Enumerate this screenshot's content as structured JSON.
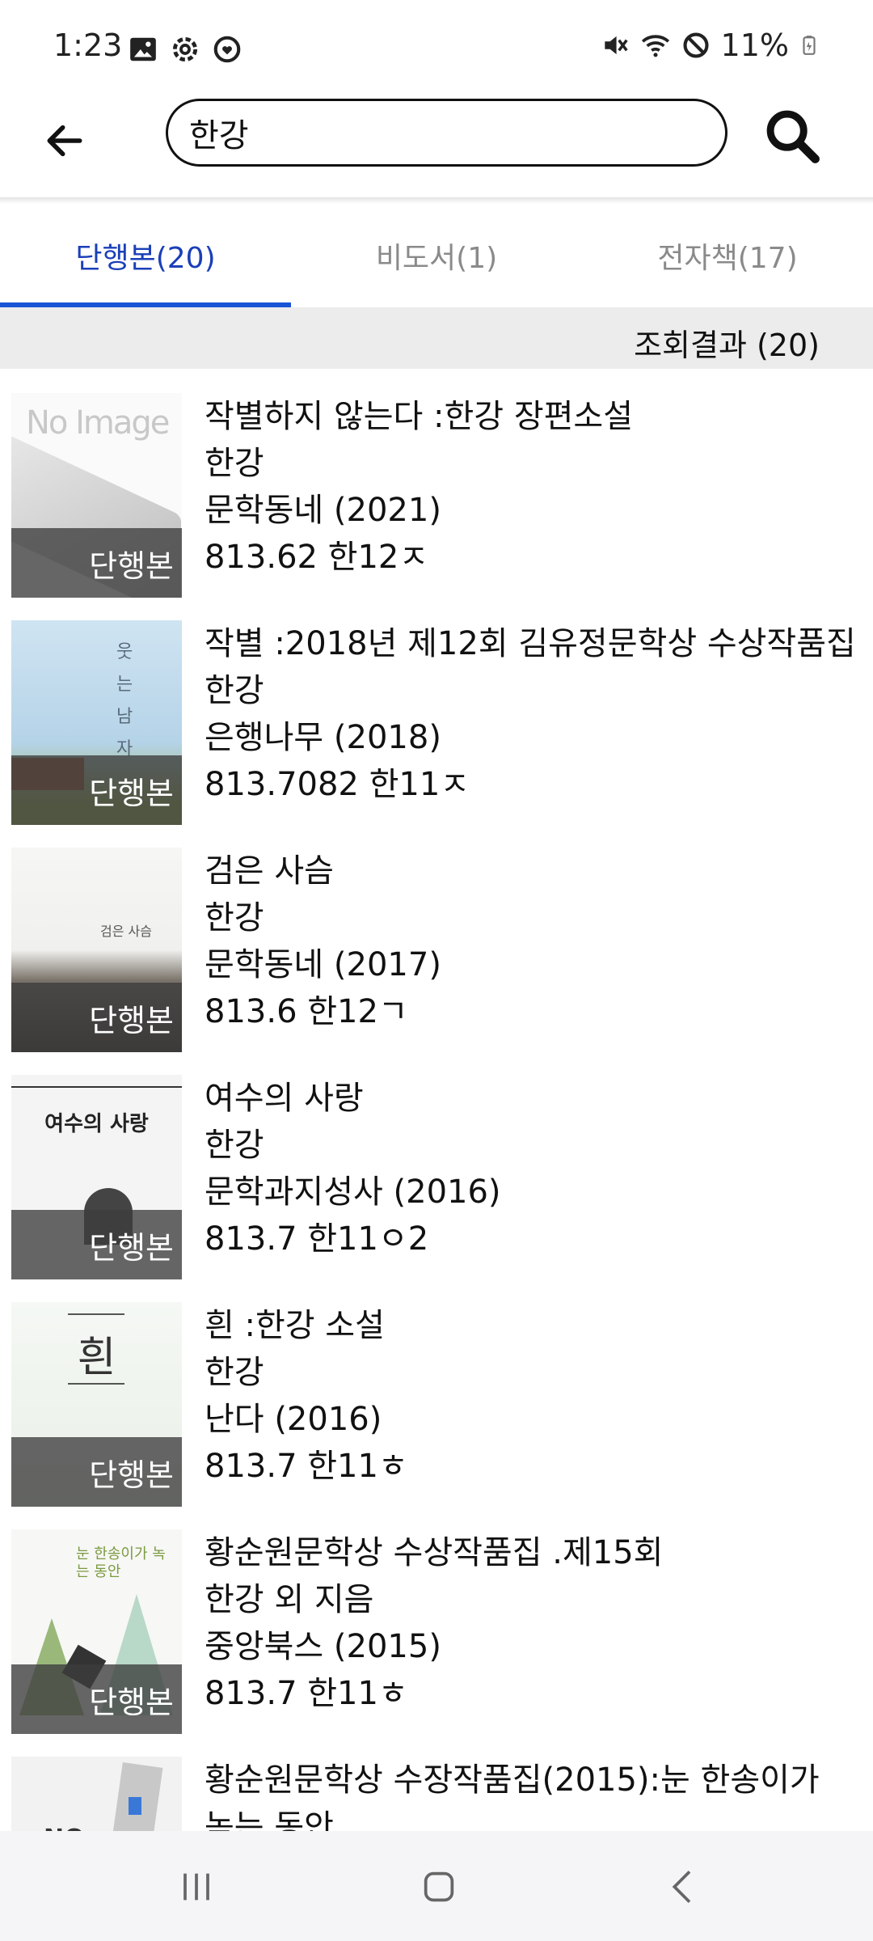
{
  "status_bar": {
    "time": "1:23",
    "battery": "11%",
    "left_icons": [
      "image-icon",
      "gear-icon",
      "clock-heart-icon"
    ],
    "right_icons": [
      "mute-icon",
      "wifi-icon",
      "blocked-icon",
      "battery-icon"
    ]
  },
  "search": {
    "query": "한강",
    "back_icon": "back-arrow-icon",
    "search_icon": "search-icon"
  },
  "tabs": [
    {
      "label": "단행본(20)",
      "active": true
    },
    {
      "label": "비도서(1)",
      "active": false
    },
    {
      "label": "전자책(17)",
      "active": false
    }
  ],
  "results": {
    "summary": "조회결과 (20)"
  },
  "books": [
    {
      "title": "작별하지 않는다 :한강 장편소설",
      "author": "한강",
      "publisher": "문학동네 (2021)",
      "call_number": "813.62 한12ㅈ",
      "badge": "단행본",
      "thumb_text": "No Image"
    },
    {
      "title": "작별 :2018년 제12회 김유정문학상 수상작품집",
      "author": "한강",
      "publisher": "은행나무 (2018)",
      "call_number": "813.7082 한11ㅈ",
      "badge": "단행본",
      "thumb_text": "웃는 남자"
    },
    {
      "title": "검은 사슴",
      "author": "한강",
      "publisher": "문학동네 (2017)",
      "call_number": "813.6 한12ㄱ",
      "badge": "단행본",
      "thumb_text": "검은 사슴"
    },
    {
      "title": "여수의 사랑",
      "author": "한강",
      "publisher": "문학과지성사 (2016)",
      "call_number": "813.7 한11ㅇ2",
      "badge": "단행본",
      "thumb_text": "여수의 사랑"
    },
    {
      "title": "흰 :한강 소설",
      "author": "한강",
      "publisher": "난다 (2016)",
      "call_number": "813.7 한11ㅎ",
      "badge": "단행본",
      "thumb_text": "흰"
    },
    {
      "title": "황순원문학상 수상작품집 .제15회",
      "author": "한강 외 지음",
      "publisher": "중앙북스 (2015)",
      "call_number": "813.7 한11ㅎ",
      "badge": "단행본",
      "thumb_text": "눈 한송이가 녹는 동안"
    },
    {
      "title": "황순원문학상 수장작품집(2015):눈 한송이가",
      "author": "녹는 동안",
      "publisher": "",
      "call_number": "",
      "badge": "",
      "thumb_text": "NO"
    }
  ],
  "navbar": {
    "recents_icon": "recents-icon",
    "home_icon": "home-icon",
    "back_icon": "nav-back-icon"
  },
  "colors": {
    "accent": "#1a55d6",
    "tab_active_text": "#1a3fb8",
    "result_bar": "#ececec",
    "badge_bg": "#3c3c3c"
  }
}
